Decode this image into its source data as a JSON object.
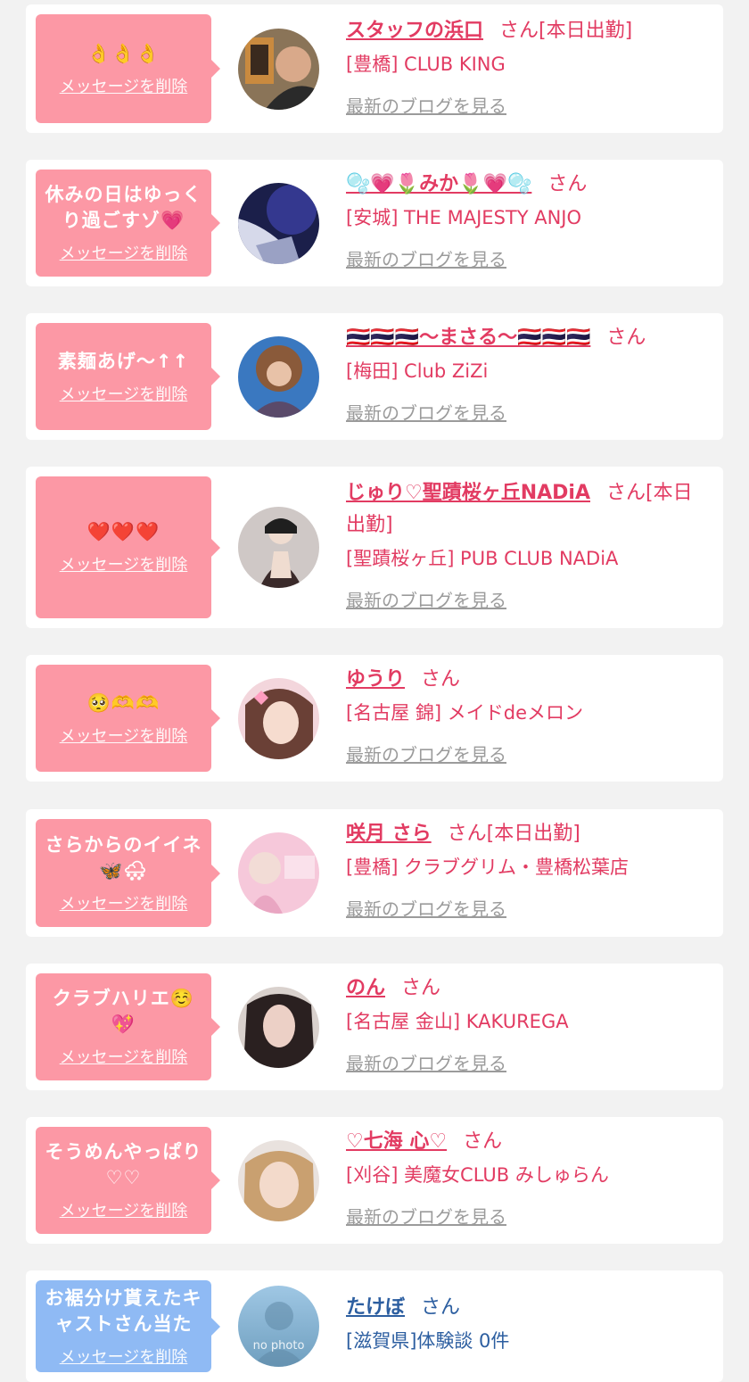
{
  "colors": {
    "pink_bubble": "#fc98a5",
    "blue_bubble": "#8fbaf4",
    "name_pink": "#e23b62",
    "name_blue": "#2c5ea0",
    "link_gray": "#9b9b9b"
  },
  "entries": [
    {
      "message": "👌👌👌",
      "delete_label": "メッセージを削除",
      "name": "スタッフの浜口",
      "suffix": "さん[本日出勤]",
      "store": "[豊橋] CLUB KING",
      "blog_link": "最新のブログを見る"
    },
    {
      "message": "休みの日はゆっくり過ごすゾ💗",
      "delete_label": "メッセージを削除",
      "name": "🫧💗🌷みか🌷💗🫧",
      "suffix": "さん",
      "store": "[安城] THE MAJESTY ANJO",
      "blog_link": "最新のブログを見る"
    },
    {
      "message": "素麺あげ〜↑↑",
      "delete_label": "メッセージを削除",
      "name": "🇹🇭🇹🇭🇹🇭〜まさる〜🇹🇭🇹🇭🇹🇭",
      "suffix": "さん",
      "store": "[梅田] Club ZiZi",
      "blog_link": "最新のブログを見る"
    },
    {
      "message": "❤️❤️❤️",
      "delete_label": "メッセージを削除",
      "name": "じゅり♡聖蹟桜ヶ丘NADiA",
      "suffix": "さん[本日出勤]",
      "store": "[聖蹟桜ヶ丘] PUB CLUB NADiA",
      "blog_link": "最新のブログを見る"
    },
    {
      "message": "🥺🫶🫶",
      "delete_label": "メッセージを削除",
      "name": "ゆうり",
      "suffix": "さん",
      "store": "[名古屋 錦] メイドdeメロン",
      "blog_link": "最新のブログを見る"
    },
    {
      "message": "さらからのイイネ🦋🌨",
      "delete_label": "メッセージを削除",
      "name": "咲月 さら",
      "suffix": "さん[本日出勤]",
      "store": "[豊橋] クラブグリム・豊橋松葉店",
      "blog_link": "最新のブログを見る"
    },
    {
      "message": "クラブハリエ☺️💖",
      "delete_label": "メッセージを削除",
      "name": "のん",
      "suffix": "さん",
      "store": "[名古屋 金山] KAKUREGA",
      "blog_link": "最新のブログを見る"
    },
    {
      "message": "そうめんやっぱり♡♡",
      "delete_label": "メッセージを削除",
      "name": "♡七海 心♡",
      "suffix": "さん",
      "store": "[刈谷] 美魔女CLUB みしゅらん",
      "blog_link": "最新のブログを見る"
    },
    {
      "message": "お裾分け貰えたキャストさん当た",
      "delete_label": "メッセージを削除",
      "name": "たけぼ",
      "suffix": "さん",
      "store": "[滋賀県]体験談 0件",
      "avatar_text": "no photo"
    }
  ]
}
